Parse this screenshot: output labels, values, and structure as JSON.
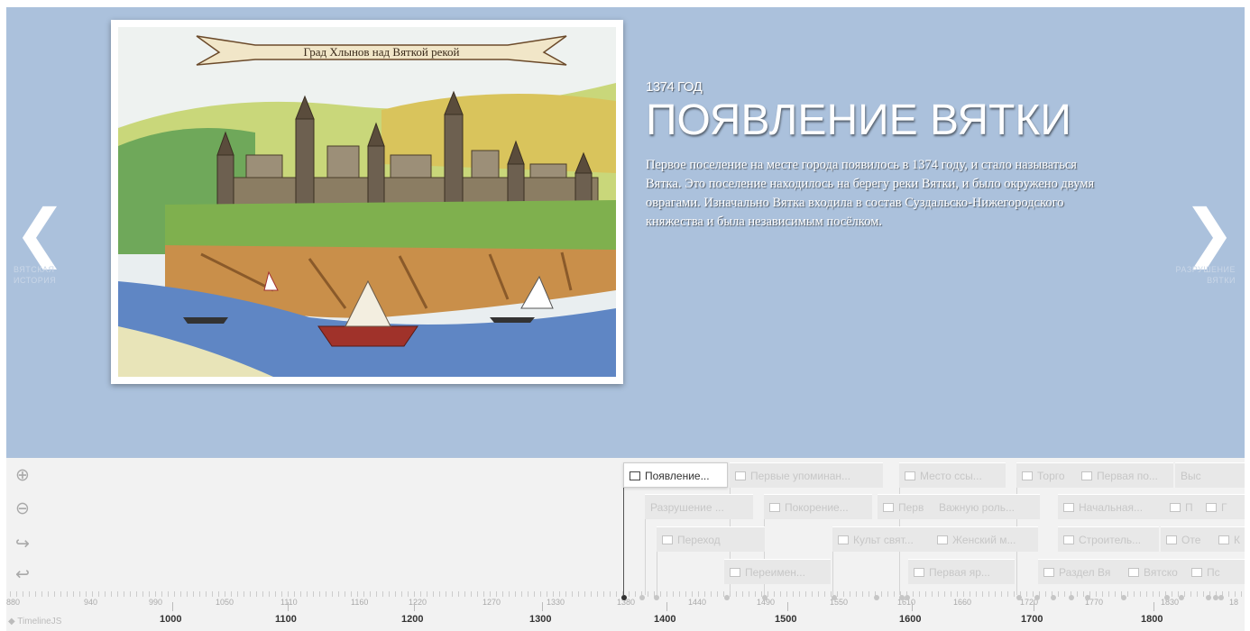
{
  "slide": {
    "year": "1374 ГОД",
    "headline": "ПОЯВЛЕНИЕ ВЯТКИ",
    "body": "Первое поселение на месте города появилось в 1374 году, и стало называться Вятка. Это поселение находилось на берегу реки Вятки, и было окружено двумя оврагами. Изначально Вятка входила в состав Суздальско-Нижегородского княжества и была независимым посёлком.",
    "image_caption": "Град Хлынов над Вяткой рекой",
    "prev_label": "Вятская история",
    "next_label": "Разрушение Вятки",
    "prev_icon": "chevron-left-icon",
    "next_icon": "chevron-right-icon",
    "background": "#abc1dc"
  },
  "timenav": {
    "zoom_in_icon": "zoom-in-icon",
    "zoom_out_icon": "zoom-out-icon",
    "back_icon": "return-icon",
    "undo_icon": "undo-icon",
    "brand": "TimelineJS",
    "markers": [
      {
        "label": "Появление...",
        "active": true
      },
      {
        "label": "Первые упоминан...",
        "active": false
      },
      {
        "label": "Место ссы...",
        "active": false
      },
      {
        "label": "Торго",
        "active": false
      },
      {
        "label": "Первая по...",
        "active": false
      },
      {
        "label": "Выс",
        "active": false
      },
      {
        "label": "Разрушение ...",
        "active": false
      },
      {
        "label": "Покорение...",
        "active": false
      },
      {
        "label": "Перв",
        "active": false
      },
      {
        "label": "Важную роль...",
        "active": false
      },
      {
        "label": "Начальная...",
        "active": false
      },
      {
        "label": "П",
        "active": false
      },
      {
        "label": "Г",
        "active": false
      },
      {
        "label": "Переход",
        "active": false
      },
      {
        "label": "Культ свят...",
        "active": false
      },
      {
        "label": "Женский м...",
        "active": false
      },
      {
        "label": "Строитель...",
        "active": false
      },
      {
        "label": "Оте",
        "active": false
      },
      {
        "label": "К",
        "active": false
      },
      {
        "label": "Переимен...",
        "active": false
      },
      {
        "label": "Первая яр...",
        "active": false
      },
      {
        "label": "Раздел Вя",
        "active": false
      },
      {
        "label": "Вятско",
        "active": false
      },
      {
        "label": "Пс",
        "active": false
      }
    ],
    "minor_labels": [
      "880",
      "940",
      "990",
      "1050",
      "1110",
      "1160",
      "1220",
      "1270",
      "1330",
      "1380",
      "1440",
      "1490",
      "1550",
      "1610",
      "1660",
      "1720",
      "1770",
      "1830",
      "18"
    ],
    "major_labels": [
      "1000",
      "1100",
      "1200",
      "1300",
      "1400",
      "1500",
      "1600",
      "1700",
      "1800"
    ]
  }
}
